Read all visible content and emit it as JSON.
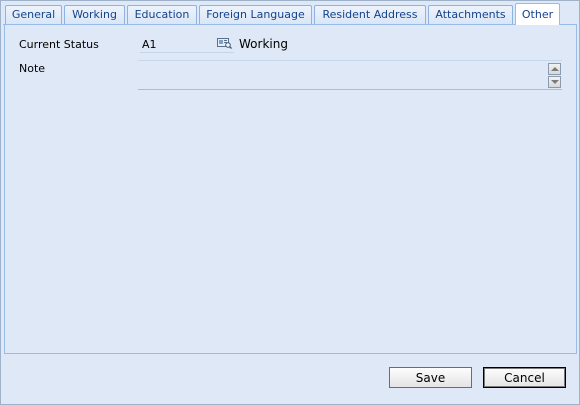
{
  "tabs": [
    {
      "label": "General"
    },
    {
      "label": "Working"
    },
    {
      "label": "Education"
    },
    {
      "label": "Foreign Language"
    },
    {
      "label": "Resident Address"
    },
    {
      "label": "Attachments"
    },
    {
      "label": "Other"
    }
  ],
  "active_tab": "Other",
  "form": {
    "current_status_label": "Current Status",
    "current_status_code": "A1",
    "current_status_name": "Working",
    "note_label": "Note",
    "note_value": ""
  },
  "footer": {
    "save_label": "Save",
    "cancel_label": "Cancel"
  },
  "icons": {
    "lookup": "lookup-icon",
    "scroll_up": "arrow-up-icon",
    "scroll_down": "arrow-down-icon"
  }
}
